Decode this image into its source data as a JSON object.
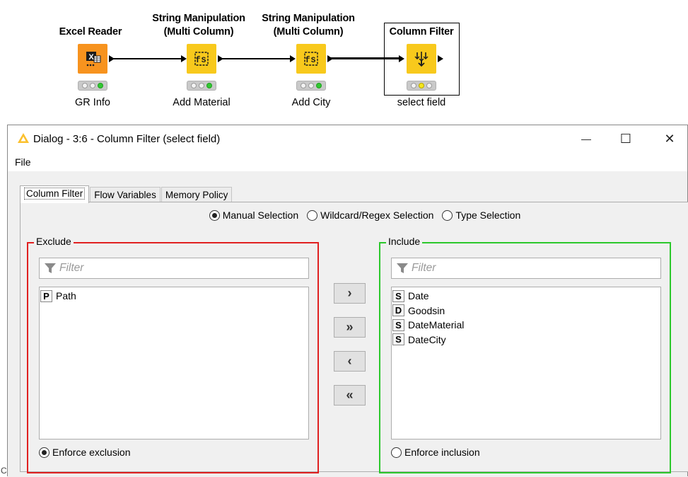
{
  "workflow": {
    "nodes": [
      {
        "title_line1": "",
        "title_line2": "Excel Reader",
        "label": "GR Info"
      },
      {
        "title_line1": "String Manipulation",
        "title_line2": "(Multi Column)",
        "label": "Add Material"
      },
      {
        "title_line1": "String Manipulation",
        "title_line2": "(Multi Column)",
        "label": "Add City"
      },
      {
        "title_line1": "",
        "title_line2": "Column Filter",
        "label": "select field"
      }
    ],
    "colors": {
      "excel_reader": "#f7931e",
      "manipulator": "#f8c91c",
      "status_green": "#32c832",
      "status_yellow": "#f4e61a"
    }
  },
  "dialog": {
    "title": "Dialog - 3:6 - Column Filter (select field)",
    "icons": {
      "app": "knime-triangle-icon",
      "minimize": "minimize-icon",
      "maximize": "maximize-icon",
      "close": "close-icon"
    },
    "minimize_glyph": "—",
    "maximize_glyph": "☐",
    "close_glyph": "✕",
    "menu": {
      "file": "File"
    },
    "tabs": [
      "Column Filter",
      "Flow Variables",
      "Memory Policy"
    ],
    "selection_modes": {
      "manual": "Manual Selection",
      "wildcard": "Wildcard/Regex Selection",
      "type": "Type Selection",
      "selected": "manual"
    },
    "exclude": {
      "label": "Exclude",
      "filter_placeholder": "Filter",
      "items": [
        {
          "type": "P",
          "name": "Path"
        }
      ],
      "enforce_label": "Enforce exclusion",
      "enforce_selected": true,
      "border_color": "#e02020"
    },
    "include": {
      "label": "Include",
      "filter_placeholder": "Filter",
      "items": [
        {
          "type": "S",
          "name": "Date"
        },
        {
          "type": "D",
          "name": "Goodsin"
        },
        {
          "type": "S",
          "name": "DateMaterial"
        },
        {
          "type": "S",
          "name": "DateCity"
        }
      ],
      "enforce_label": "Enforce inclusion",
      "enforce_selected": false,
      "border_color": "#2cc82c"
    },
    "move_buttons": {
      "add": "›",
      "add_all": "»",
      "remove": "‹",
      "remove_all": "«"
    }
  },
  "edge": {
    "letter": "C"
  }
}
